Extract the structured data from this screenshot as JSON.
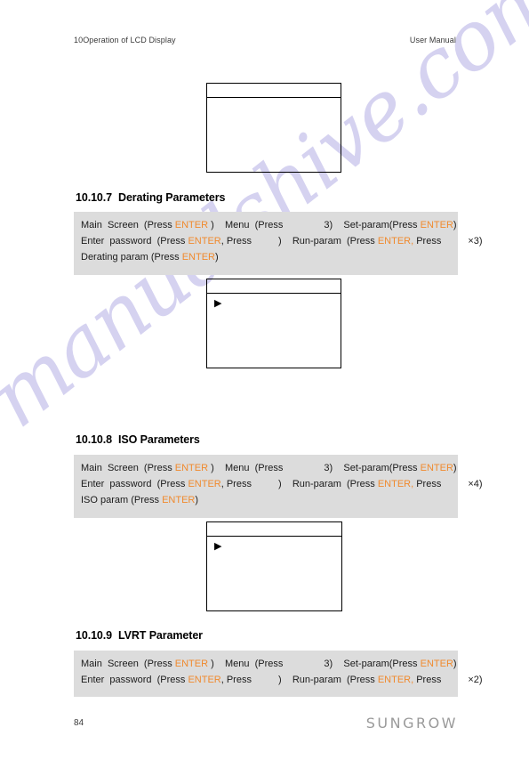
{
  "header": {
    "left": "10Operation of LCD Display",
    "right": "User Manual"
  },
  "watermark": {
    "text": "manualshive.com"
  },
  "colors": {
    "key_highlight": "#f08a2e",
    "panel_bg": "#dcdcdc",
    "logo_gray": "#9a9a9a"
  },
  "displays": {
    "top": {
      "cursor": ""
    },
    "derating": {
      "cursor": "▶"
    },
    "iso": {
      "cursor": "▶"
    }
  },
  "sections": [
    {
      "number": "10.10.7",
      "title": "Derating Parameters",
      "lines": [
        [
          {
            "t": "Main  Screen  (Press "
          },
          {
            "t": "ENTER",
            "k": true
          },
          {
            "t": " )    Menu  (Press"
          },
          {
            "t": "",
            "gap": "lg"
          },
          {
            "t": "3)    Set-param(Press "
          },
          {
            "t": "ENTER",
            "k": true
          },
          {
            "t": ")"
          }
        ],
        [
          {
            "t": "Enter  password  (Press "
          },
          {
            "t": "ENTER",
            "k": true
          },
          {
            "t": ", Press"
          },
          {
            "t": "",
            "gap": "md"
          },
          {
            "t": ")    Run-param  (Press "
          },
          {
            "t": "ENTER,",
            "k": true
          },
          {
            "t": " Press"
          },
          {
            "t": "",
            "gap": "md"
          },
          {
            "t": "×3)"
          }
        ],
        [
          {
            "t": "Derating param (Press "
          },
          {
            "t": "ENTER",
            "k": true
          },
          {
            "t": ")"
          }
        ]
      ]
    },
    {
      "number": "10.10.8",
      "title": "ISO Parameters",
      "lines": [
        [
          {
            "t": "Main  Screen  (Press "
          },
          {
            "t": "ENTER",
            "k": true
          },
          {
            "t": " )    Menu  (Press"
          },
          {
            "t": "",
            "gap": "lg"
          },
          {
            "t": "3)    Set-param(Press "
          },
          {
            "t": "ENTER",
            "k": true
          },
          {
            "t": ")"
          }
        ],
        [
          {
            "t": "Enter  password  (Press "
          },
          {
            "t": "ENTER",
            "k": true
          },
          {
            "t": ", Press"
          },
          {
            "t": "",
            "gap": "md"
          },
          {
            "t": ")    Run-param  (Press "
          },
          {
            "t": "ENTER,",
            "k": true
          },
          {
            "t": " Press"
          },
          {
            "t": "",
            "gap": "md"
          },
          {
            "t": "×4)"
          }
        ],
        [
          {
            "t": "ISO param (Press "
          },
          {
            "t": "ENTER",
            "k": true
          },
          {
            "t": ")"
          }
        ]
      ]
    },
    {
      "number": "10.10.9",
      "title": "LVRT Parameter",
      "lines": [
        [
          {
            "t": "Main  Screen  (Press "
          },
          {
            "t": "ENTER",
            "k": true
          },
          {
            "t": " )    Menu  (Press"
          },
          {
            "t": "",
            "gap": "lg"
          },
          {
            "t": "3)    Set-param(Press "
          },
          {
            "t": "ENTER",
            "k": true
          },
          {
            "t": ")"
          }
        ],
        [
          {
            "t": "Enter  password  (Press "
          },
          {
            "t": "ENTER",
            "k": true
          },
          {
            "t": ", Press"
          },
          {
            "t": "",
            "gap": "md"
          },
          {
            "t": ")    Run-param  (Press "
          },
          {
            "t": "ENTER,",
            "k": true
          },
          {
            "t": " Press"
          },
          {
            "t": "",
            "gap": "md"
          },
          {
            "t": "×2)"
          }
        ]
      ]
    }
  ],
  "footer": {
    "page_number": "84",
    "brand": "SUNGROW"
  }
}
